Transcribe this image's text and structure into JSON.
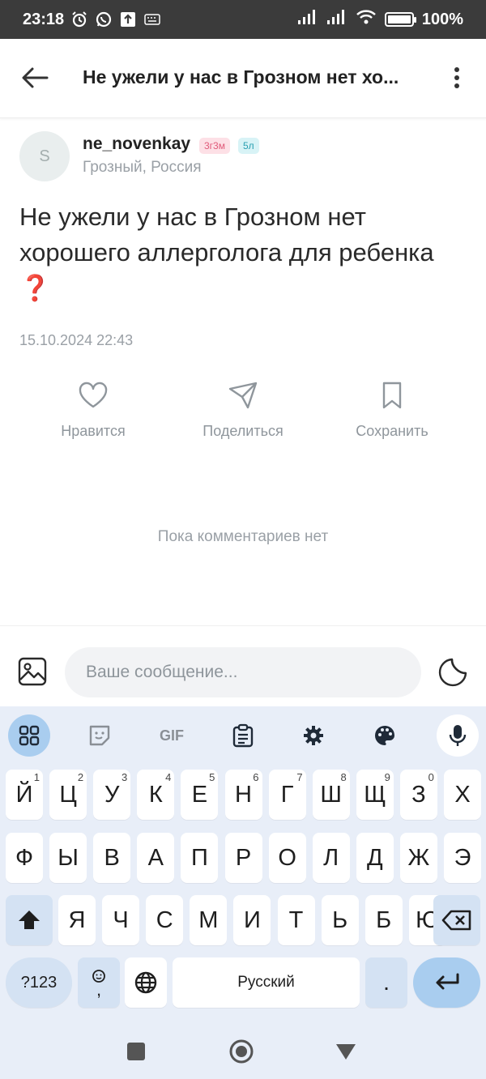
{
  "status_bar": {
    "time": "23:18",
    "battery": "100%",
    "battery_fraction": 1.0
  },
  "header": {
    "title": "Не ужели у нас в Грозном нет хо..."
  },
  "post": {
    "author": {
      "avatar_letter": "S",
      "username": "ne_novenkay",
      "badge_age": "3г3м",
      "badge_years": "5л",
      "location": "Грозный, Россия"
    },
    "text": "Не ужели у нас в Грозном нет хорошего аллерголога для ребенка ",
    "emoji": "❓",
    "date": "15.10.2024 22:43",
    "actions": {
      "like": "Нравится",
      "share": "Поделиться",
      "save": "Сохранить"
    }
  },
  "comments": {
    "empty_text": "Пока комментариев нет"
  },
  "composer": {
    "placeholder": "Ваше сообщение..."
  },
  "keyboard": {
    "toolbar_gif": "GIF",
    "row1": [
      {
        "k": "Й",
        "s": "1"
      },
      {
        "k": "Ц",
        "s": "2"
      },
      {
        "k": "У",
        "s": "3"
      },
      {
        "k": "К",
        "s": "4"
      },
      {
        "k": "Е",
        "s": "5"
      },
      {
        "k": "Н",
        "s": "6"
      },
      {
        "k": "Г",
        "s": "7"
      },
      {
        "k": "Ш",
        "s": "8"
      },
      {
        "k": "Щ",
        "s": "9"
      },
      {
        "k": "З",
        "s": "0"
      },
      {
        "k": "Х",
        "s": ""
      }
    ],
    "row2": [
      "Ф",
      "Ы",
      "В",
      "А",
      "П",
      "Р",
      "О",
      "Л",
      "Д",
      "Ж",
      "Э"
    ],
    "row3": [
      "Я",
      "Ч",
      "С",
      "М",
      "И",
      "Т",
      "Ь",
      "Б",
      "Ю"
    ],
    "sym_key": "?123",
    "comma_key": ",",
    "space_label": "Русский",
    "period_key": "."
  },
  "colors": {
    "accent_key": "#a9cdef",
    "keyboard_bg": "#e8eef8",
    "status_bar": "#3b3b3b"
  }
}
